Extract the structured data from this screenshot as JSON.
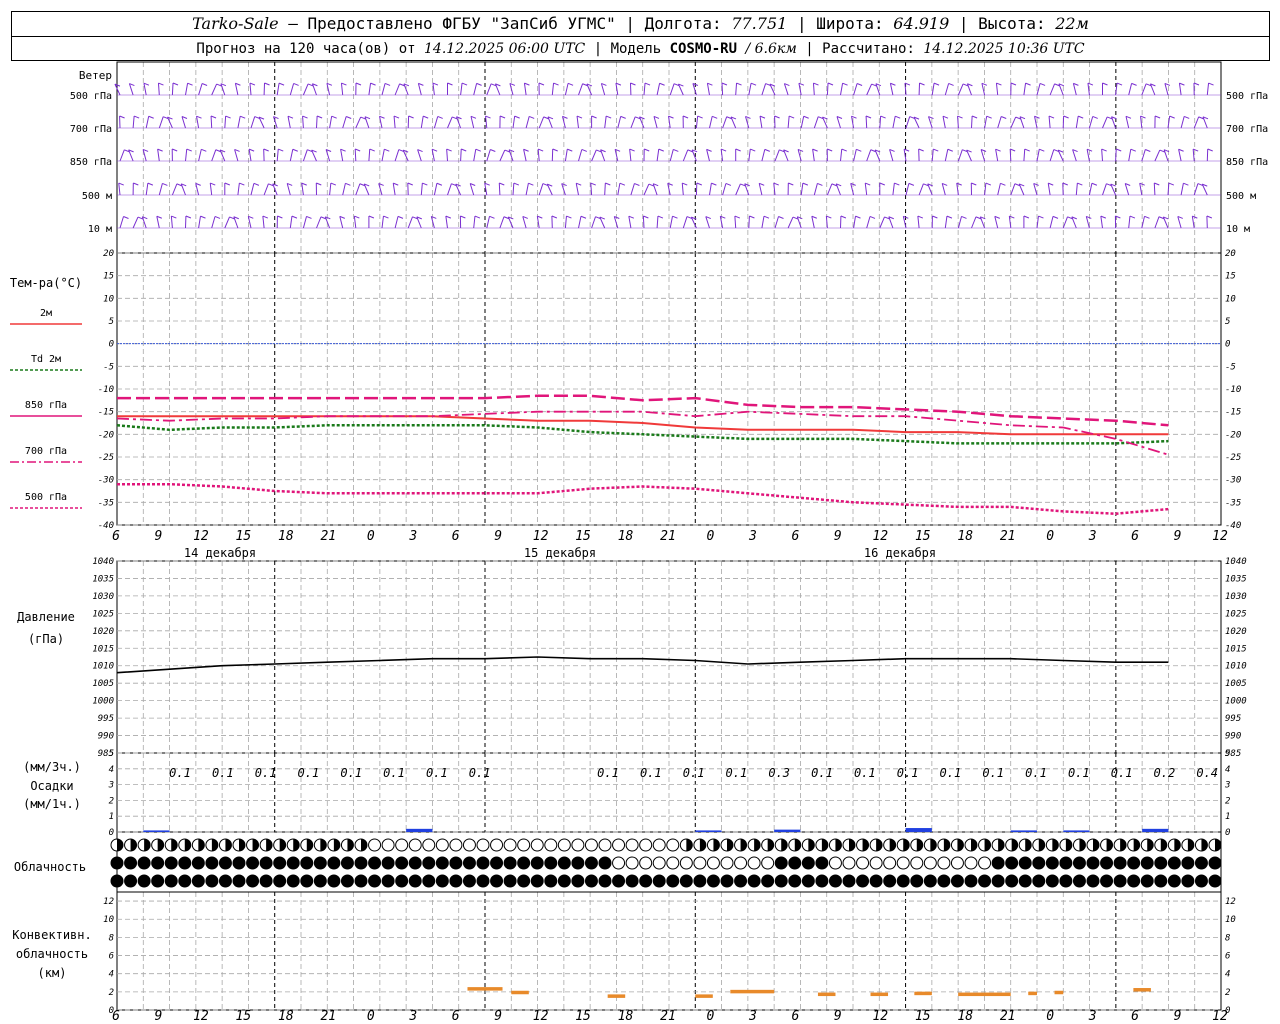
{
  "header": {
    "station": "Tarko-Sale",
    "provider": "– Предоставлено ФГБУ \"ЗапСиб УГМС\"",
    "lon_label": "Долгота:",
    "lon": "77.751",
    "lat_label": "Широта:",
    "lat": "64.919",
    "alt_label": "Высота:",
    "alt": "22м",
    "forecast_prefix": "Прогноз на 120 часа(ов) от",
    "forecast_time": "14.12.2025 06:00 UTC",
    "model_label": "Модель",
    "model": "COSMO-RU",
    "resolution": "/ 6.6км",
    "computed_label": "Рассчитано:",
    "computed_time": "14.12.2025 10:36 UTC"
  },
  "colors": {
    "wind": "#7a2fd0",
    "t2m": "#f03a3a",
    "td2m": "#1a7a1a",
    "t_levels": "#e0157a",
    "pressure": "#000000",
    "precip": "#2040e0",
    "convective": "#e88a2a",
    "grid": "#a8a8a8"
  },
  "time_axis": {
    "labels": [
      "6",
      "9",
      "12",
      "15",
      "18",
      "21",
      "0",
      "3",
      "6",
      "9",
      "12",
      "15",
      "18",
      "21",
      "0",
      "3",
      "6",
      "9",
      "12",
      "15",
      "18",
      "21",
      "0",
      "3",
      "6",
      "9",
      "12"
    ],
    "days": [
      "14 декабря",
      "15 декабря",
      "16 декабря"
    ]
  },
  "panels": {
    "wind": {
      "title": "Ветер",
      "levels": [
        "500 гПа",
        "700 гПа",
        "850 гПа",
        "500 м",
        "10 м"
      ]
    },
    "temp": {
      "title": "Тем-ра(°C)",
      "legend": [
        "2м",
        "Td 2м",
        "850 гПа",
        "700 гПа",
        "500 гПа"
      ],
      "ticks": [
        "20",
        "15",
        "10",
        "5",
        "0",
        "-5",
        "-10",
        "-15",
        "-20",
        "-25",
        "-30",
        "-35",
        "-40"
      ]
    },
    "pressure": {
      "title1": "Давление",
      "title2": "(гПа)",
      "ticks": [
        "1040",
        "1035",
        "1030",
        "1025",
        "1020",
        "1015",
        "1010",
        "1005",
        "1000",
        "995",
        "990",
        "985"
      ]
    },
    "precip": {
      "title1": "(мм/3ч.)",
      "title2": "Осадки",
      "title3": "(мм/1ч.)",
      "ticks": [
        "5",
        "4",
        "3",
        "2",
        "1",
        "0"
      ],
      "sums": [
        "0.1",
        "0.1",
        "0.1",
        "0.1",
        "0.1",
        "0.1",
        "0.1",
        "0.1",
        "",
        "",
        "0.1",
        "0.1",
        "0.1",
        "0.1",
        "0.3",
        "0.1",
        "0.1",
        "0.1",
        "0.1",
        "0.1",
        "0.1",
        "0.1",
        "0.1",
        "0.2",
        "0.4"
      ]
    },
    "cloud": {
      "title": "Облачность"
    },
    "conv": {
      "title1": "Конвективн.",
      "title2": "облачность",
      "title3": "(км)",
      "ticks": [
        "12",
        "10",
        "8",
        "6",
        "4",
        "2",
        "0"
      ]
    }
  },
  "chart_data": [
    {
      "type": "line",
      "title": "Тем-ра(°C)",
      "x_hours": [
        0,
        6,
        12,
        18,
        24,
        30,
        36,
        42,
        48,
        54,
        60,
        66,
        72,
        78,
        84,
        90,
        96,
        102,
        108,
        114,
        120
      ],
      "ylim": [
        -40,
        20
      ],
      "series": [
        {
          "name": "2м",
          "values": [
            -16,
            -16,
            -16,
            -16,
            -16,
            -16,
            -16,
            -16.5,
            -17,
            -17,
            -17.5,
            -18.5,
            -19,
            -19,
            -19,
            -19.5,
            -19.5,
            -20,
            -20,
            -20,
            -20
          ]
        },
        {
          "name": "Td 2м",
          "values": [
            -18,
            -19,
            -18.5,
            -18.5,
            -18,
            -18,
            -18,
            -18,
            -18.5,
            -19.5,
            -20,
            -20.5,
            -21,
            -21,
            -21,
            -21.5,
            -22,
            -22,
            -22,
            -22,
            -21.5
          ]
        },
        {
          "name": "850 гПа",
          "values": [
            -12,
            -12,
            -12,
            -12,
            -12,
            -12,
            -12,
            -12,
            -11.5,
            -11.5,
            -12.5,
            -12,
            -13.5,
            -14,
            -14,
            -14.5,
            -15,
            -16,
            -16.5,
            -17,
            -18
          ]
        },
        {
          "name": "700 гПа",
          "values": [
            -16.5,
            -17,
            -16.5,
            -16.5,
            -16,
            -16,
            -16,
            -15.5,
            -15,
            -15,
            -15,
            -16,
            -15,
            -15.5,
            -16,
            -16,
            -17,
            -18,
            -18.5,
            -21,
            -24.5
          ]
        },
        {
          "name": "500 гПа",
          "values": [
            -31,
            -31,
            -31.5,
            -32.5,
            -33,
            -33,
            -33,
            -33,
            -33,
            -32,
            -31.5,
            -32,
            -33,
            -34,
            -35,
            -35.5,
            -36,
            -36,
            -37,
            -37.5,
            -36.5
          ]
        }
      ]
    },
    {
      "type": "line",
      "title": "Давление",
      "ylabel": "(гПа)",
      "x_hours": [
        0,
        6,
        12,
        18,
        24,
        30,
        36,
        42,
        48,
        54,
        60,
        66,
        72,
        78,
        84,
        90,
        96,
        102,
        108,
        114,
        120
      ],
      "ylim": [
        985,
        1040
      ],
      "series": [
        {
          "name": "Давление",
          "values": [
            1008,
            1009,
            1010,
            1010.5,
            1011,
            1011.5,
            1012,
            1012,
            1012.5,
            1012,
            1012,
            1011.5,
            1010.5,
            1011,
            1011.5,
            1012,
            1012,
            1012,
            1011.5,
            1011,
            1011
          ]
        }
      ]
    },
    {
      "type": "bar",
      "title": "Осадки",
      "ylabel": "(мм/1ч.)",
      "ylim": [
        0,
        5
      ],
      "bars": [
        [
          3,
          6,
          0.1
        ],
        [
          33,
          36,
          0.2
        ],
        [
          66,
          69,
          0.1
        ],
        [
          75,
          78,
          0.15
        ],
        [
          90,
          93,
          0.25
        ],
        [
          102,
          105,
          0.1
        ],
        [
          108,
          111,
          0.1
        ],
        [
          117,
          120,
          0.2
        ]
      ]
    },
    {
      "type": "bar",
      "title": "Конвективн.",
      "ylabel": "(км)",
      "ylim": [
        0,
        13
      ],
      "bars": [
        [
          40,
          44,
          2.3
        ],
        [
          45,
          47,
          1.9
        ],
        [
          56,
          58,
          1.5
        ],
        [
          66,
          68,
          1.5
        ],
        [
          70,
          75,
          2
        ],
        [
          80,
          82,
          1.7
        ],
        [
          86,
          88,
          1.7
        ],
        [
          91,
          93,
          1.8
        ],
        [
          96,
          102,
          1.7
        ],
        [
          104,
          105,
          1.8
        ],
        [
          107,
          108,
          1.9
        ],
        [
          116,
          118,
          2.2
        ]
      ]
    }
  ]
}
